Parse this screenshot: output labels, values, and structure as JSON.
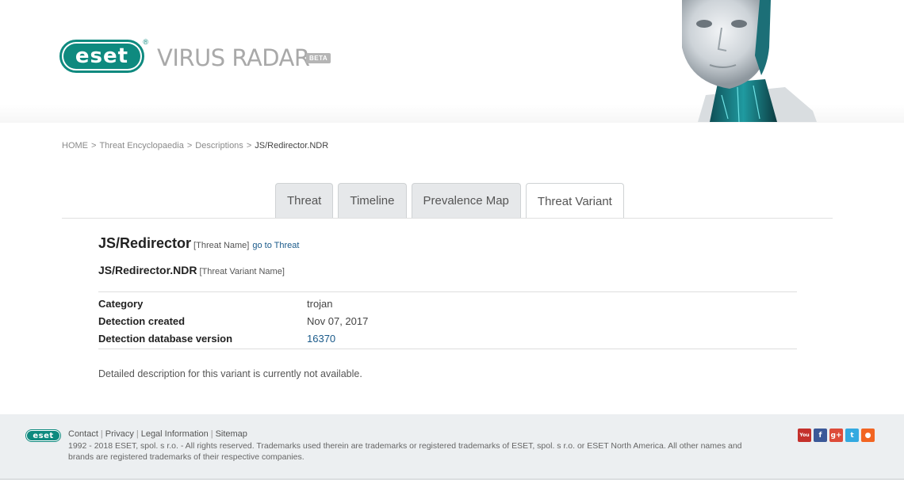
{
  "brand": {
    "logo_text": "eset",
    "logo_reg": "®",
    "title": "VIRUS RADAR",
    "badge": "BETA"
  },
  "breadcrumb": {
    "items": [
      "HOME",
      "Threat Encyclopaedia",
      "Descriptions"
    ],
    "separator": ">",
    "current": "JS/Redirector.NDR"
  },
  "tabs": [
    {
      "label": "Threat",
      "active": false
    },
    {
      "label": "Timeline",
      "active": false
    },
    {
      "label": "Prevalence Map",
      "active": false
    },
    {
      "label": "Threat Variant",
      "active": true
    }
  ],
  "threat": {
    "name": "JS/Redirector",
    "name_tag": "[Threat Name]",
    "go_link": "go to Threat",
    "variant": "JS/Redirector.NDR",
    "variant_tag": "[Threat Variant Name]"
  },
  "info": [
    {
      "label": "Category",
      "value": "trojan"
    },
    {
      "label": "Detection created",
      "value": "Nov 07, 2017"
    },
    {
      "label": "Detection database version",
      "value": "16370"
    }
  ],
  "description": "Detailed description for this variant is currently not available.",
  "footer": {
    "logo_text": "eset",
    "links": [
      "Contact",
      "Privacy",
      "Legal Information",
      "Sitemap"
    ],
    "copyright": "1992 - 2018 ESET, spol. s r.o. - All rights reserved. Trademarks used therein are trademarks or registered trademarks of ESET, spol. s r.o. or ESET North America. All other names and brands are registered trademarks of their respective companies.",
    "social": [
      {
        "name": "youtube-icon",
        "glyph": "You",
        "color": "#c4302b"
      },
      {
        "name": "facebook-icon",
        "glyph": "f",
        "color": "#3b5998"
      },
      {
        "name": "google-plus-icon",
        "glyph": "g+",
        "color": "#dd4b39"
      },
      {
        "name": "twitter-icon",
        "glyph": "t",
        "color": "#33a9e0"
      },
      {
        "name": "rss-icon",
        "glyph": "●",
        "color": "#f26522"
      }
    ]
  },
  "colors": {
    "brand_teal": "#0e8a7f",
    "link_blue": "#1a5a8a"
  }
}
